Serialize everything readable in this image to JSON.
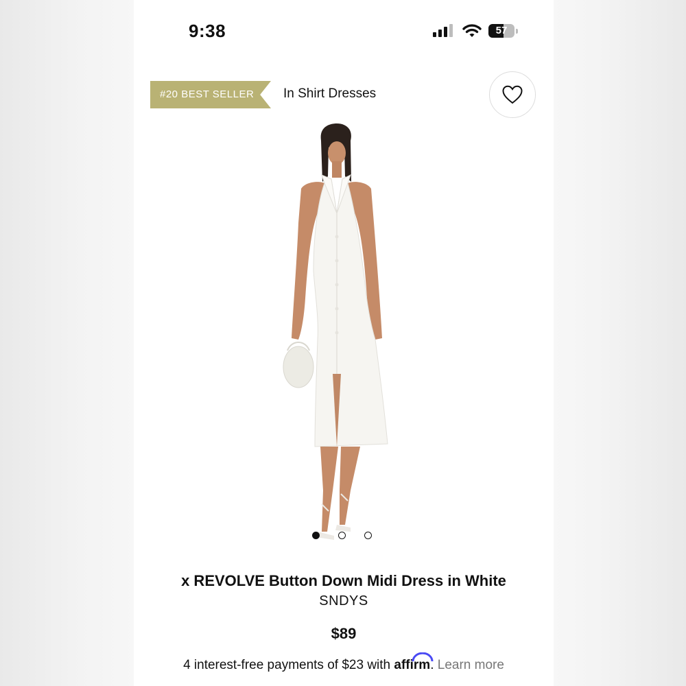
{
  "status_bar": {
    "time": "9:38",
    "battery_level": "57",
    "battery_fraction": 0.57,
    "icons": [
      "signal-icon",
      "wifi-icon",
      "battery-icon"
    ]
  },
  "badge": {
    "label": "#20 BEST SELLER",
    "color": "#b9b274"
  },
  "category": {
    "label": "In Shirt Dresses"
  },
  "favorite": {
    "icon": "heart-icon"
  },
  "carousel": {
    "count": 3,
    "active_index": 0
  },
  "product": {
    "title": "x REVOLVE Button Down Midi Dress in White",
    "brand": "SNDYS",
    "price": "$89"
  },
  "payment": {
    "text": "4 interest-free payments of $23 with",
    "provider": "affirm",
    "link": "Learn more",
    "provider_accent": "#4a4af4"
  }
}
